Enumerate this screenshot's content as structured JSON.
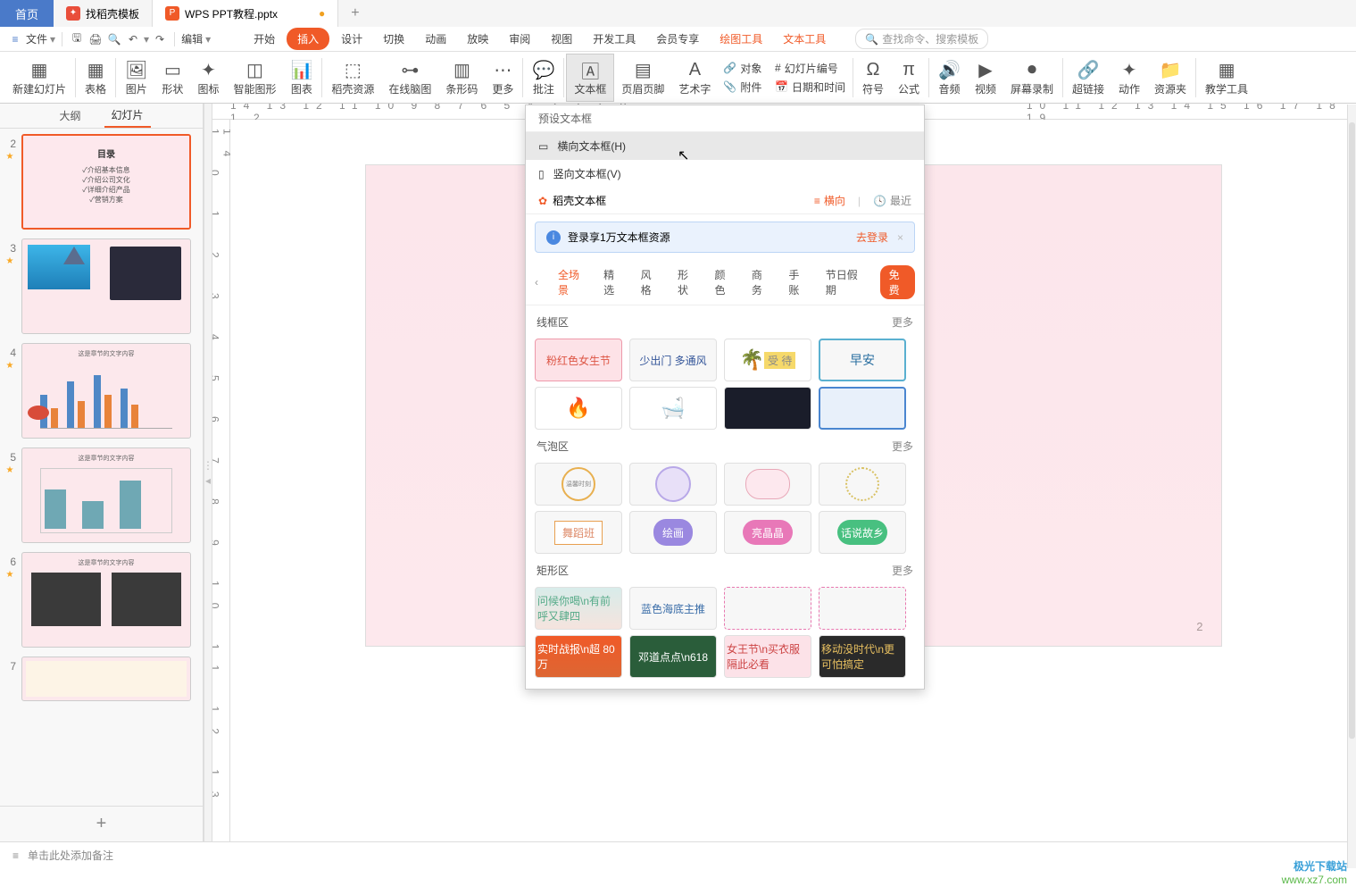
{
  "titlebar": {
    "home": "首页",
    "tab1": "找稻壳模板",
    "tab2": "WPS PPT教程.pptx",
    "plus": "+"
  },
  "menubar": {
    "file": "文件",
    "edit": "编辑",
    "items": [
      "开始",
      "插入",
      "设计",
      "切换",
      "动画",
      "放映",
      "审阅",
      "视图",
      "开发工具",
      "会员专享",
      "绘图工具",
      "文本工具"
    ],
    "search_ph": "查找命令、搜索模板"
  },
  "ribbon": {
    "left": [
      "新建幻灯片",
      "表格",
      "图片",
      "形状",
      "图标",
      "智能图形",
      "图表",
      "稻壳资源",
      "在线脑图",
      "条形码",
      "更多",
      "批注",
      "文本框",
      "页眉页脚",
      "艺术字"
    ],
    "sub": [
      {
        "icon": "📎",
        "label": "对象"
      },
      {
        "icon": "🖼",
        "label": "幻灯片编号"
      },
      {
        "icon": "📎",
        "label": "附件"
      },
      {
        "icon": "📅",
        "label": "日期和时间"
      }
    ],
    "right": [
      "符号",
      "公式",
      "音频",
      "视频",
      "屏幕录制",
      "超链接",
      "动作",
      "资源夹",
      "教学工具"
    ]
  },
  "sidepanel": {
    "tabs": [
      "大纲",
      "幻灯片"
    ],
    "slides": [
      {
        "n": "2",
        "title": "目录",
        "lines": [
          "✓介绍基本信息",
          "✓介绍公司文化",
          "✓详细介绍产品",
          "✓营销方案"
        ]
      },
      {
        "n": "3",
        "title": ""
      },
      {
        "n": "4",
        "title": "这是章节的文字内容"
      },
      {
        "n": "5",
        "title": "这是章节的文字内容"
      },
      {
        "n": "6",
        "title": "这是章节的文字内容"
      },
      {
        "n": "7",
        "title": ""
      }
    ]
  },
  "canvas": {
    "page": "2"
  },
  "dropdown": {
    "preset": "预设文本框",
    "h": "横向文本框(H)",
    "v": "竖向文本框(V)",
    "dk": "稻壳文本框",
    "horiz": "横向",
    "recent": "最近",
    "login_msg": "登录享1万文本框资源",
    "go_login": "去登录",
    "filters": [
      "全场景",
      "精选",
      "风格",
      "形状",
      "颜色",
      "商务",
      "手账",
      "节日假期"
    ],
    "free": "免费",
    "sec1": "线框区",
    "sec2": "气泡区",
    "sec3": "矩形区",
    "more": "更多",
    "tiles1": [
      "粉红色女生节",
      "少出门 多通风",
      "受 待",
      "早安"
    ],
    "tiles2": [
      "",
      "",
      "",
      ""
    ],
    "bubbles1": [
      "温馨时刻",
      "",
      "",
      ""
    ],
    "bubbles2": [
      "舞蹈班",
      "绘画",
      "亮晶晶",
      "话说故乡"
    ],
    "rect1": [
      "问候你喝\\n有前呼又肆四",
      "蓝色海底主推",
      "",
      ""
    ],
    "rect2": [
      "实时战报\\n超 80 万",
      "邓道点点\\n618",
      "女王节\\n买衣服隔此必看",
      "移动没时代\\n更可怕搞定"
    ]
  },
  "notes": {
    "placeholder": "单击此处添加备注"
  },
  "ruler_h": "14  13  12  11  10  9  8  7  6  5  4  3  2  1  0  1  2",
  "ruler_h2": "10  11  12  13  14  15  16  17  18  19",
  "ruler_v": "1 0 1 2 3 4 5 6 7 8 9 10 11 12 13 14",
  "wm1": "极光下载站",
  "wm2": "www.xz7.com"
}
